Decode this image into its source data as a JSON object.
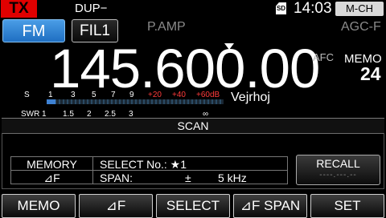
{
  "status": {
    "tx": "TX",
    "dup": "DUP−",
    "sd": "SD",
    "time": "14:03",
    "mode_badge": "M-CH"
  },
  "controls": {
    "mode": "FM",
    "filter": "FIL1",
    "pamp": "P.AMP",
    "agc": "AGC-F"
  },
  "main": {
    "frequency": "145.600.00",
    "afc": "AFC",
    "memo_label": "MEMO",
    "memo_channel": "24",
    "memo_name": "Vejrhoj"
  },
  "meter": {
    "s_label": "S",
    "s_scale": [
      "1",
      "3",
      "5",
      "7",
      "9"
    ],
    "plus_scale": [
      "+20",
      "+40",
      "+60dB"
    ],
    "swr_label": "SWR",
    "swr_scale": [
      "1",
      "1.5",
      "2",
      "2.5",
      "3",
      "∞"
    ],
    "signal_level": 0.05
  },
  "scan": {
    "title": "SCAN",
    "memory_label": "MEMORY",
    "delta_f_label": "⊿F",
    "select_label": "SELECT No.: ★1",
    "span_label": "SPAN:",
    "span_pm": "±",
    "span_value": "5 kHz",
    "recall_label": "RECALL",
    "recall_value": "----.---.--"
  },
  "fkeys": [
    "MEMO",
    "⊿F",
    "SELECT",
    "⊿F SPAN",
    "SET"
  ],
  "colors": {
    "tx_red": "#e00000",
    "fm_blue": "#2f86d8",
    "meter_red": "#ff3b3b",
    "meter_bar": "#3e82d4"
  }
}
